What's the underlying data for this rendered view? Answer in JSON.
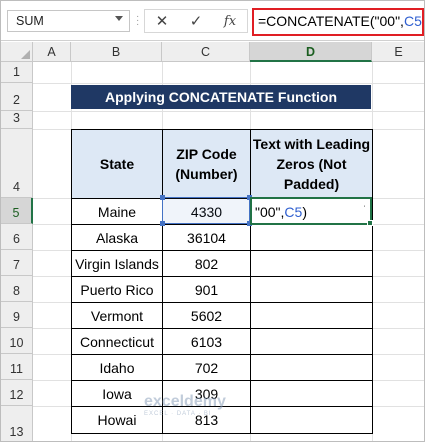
{
  "name_box": {
    "value": "SUM"
  },
  "formula_bar": {
    "cancel_label": "✕",
    "enter_label": "✓",
    "fx_label": "fx",
    "formula_prefix": "=CONCATENATE(\"00\",",
    "formula_ref": "C5",
    "formula_suffix": ")"
  },
  "columns": [
    "A",
    "B",
    "C",
    "D",
    "E"
  ],
  "rows": [
    "1",
    "2",
    "3",
    "4",
    "5",
    "6",
    "7",
    "8",
    "9",
    "10",
    "11",
    "12",
    "13"
  ],
  "title": "Applying CONCATENATE Function",
  "table": {
    "headers": [
      "State",
      "ZIP Code (Number)",
      "Text with Leading Zeros (Not Padded)"
    ],
    "rows": [
      {
        "state": "Maine",
        "zip": "4330"
      },
      {
        "state": "Alaska",
        "zip": "36104"
      },
      {
        "state": "Virgin Islands",
        "zip": "802"
      },
      {
        "state": "Puerto Rico",
        "zip": "901"
      },
      {
        "state": "Vermont",
        "zip": "5602"
      },
      {
        "state": "Connecticut",
        "zip": "6103"
      },
      {
        "state": "Idaho",
        "zip": "702"
      },
      {
        "state": "Iowa",
        "zip": "309"
      },
      {
        "state": "Howai",
        "zip": "813"
      }
    ]
  },
  "editing_cell": {
    "prefix": "\"00\",",
    "ref": "C5",
    "suffix": ")"
  },
  "watermark": {
    "name": "exceldemy",
    "tagline": "EXCEL · DATA · BI"
  },
  "colors": {
    "title_bg": "#1f3864",
    "header_bg": "#dde8f5",
    "active_border": "#217346",
    "formula_highlight": "#e01e24",
    "reference": "#4472c4"
  }
}
